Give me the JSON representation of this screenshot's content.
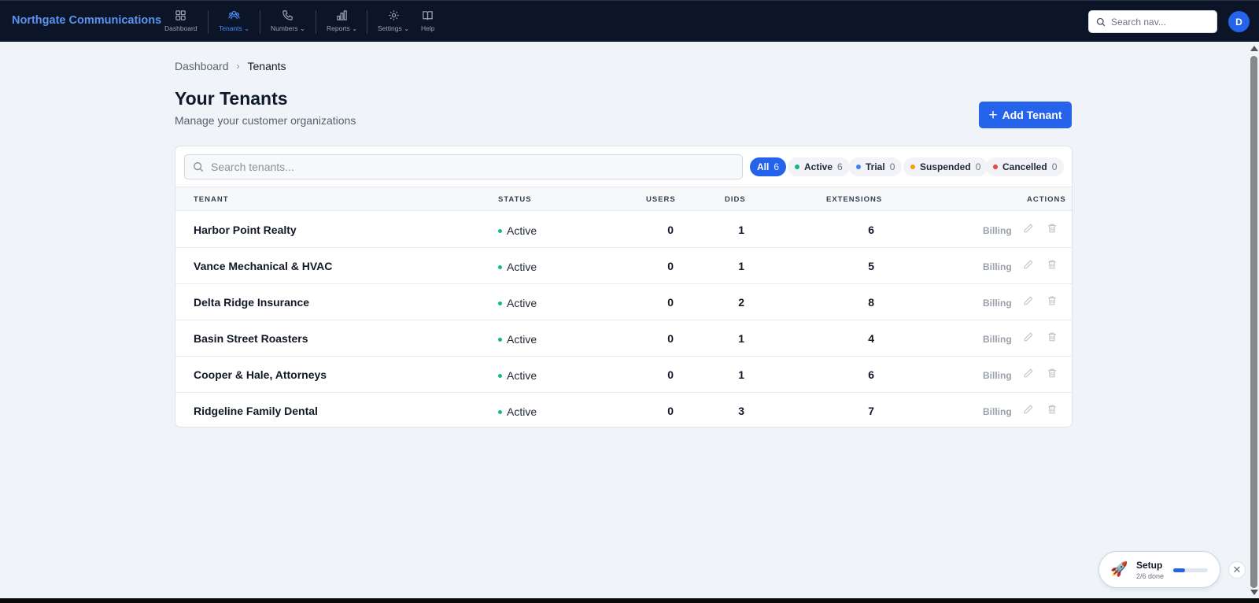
{
  "app": {
    "brand": "Northgate Communications"
  },
  "nav": {
    "items": [
      {
        "label": "Dashboard",
        "icon": "grid-icon"
      },
      {
        "label": "Tenants",
        "icon": "users-icon",
        "active": true
      },
      {
        "label": "Numbers",
        "icon": "phone-icon"
      },
      {
        "label": "Reports",
        "icon": "bar-chart-icon"
      },
      {
        "label": "Settings",
        "icon": "gear-icon"
      },
      {
        "label": "Help",
        "icon": "book-icon"
      }
    ],
    "search_placeholder": "Search nav...",
    "avatar_initial": "D"
  },
  "breadcrumb": {
    "root": "Dashboard",
    "current": "Tenants"
  },
  "header": {
    "title": "Your Tenants",
    "subtitle": "Manage your customer organizations",
    "add_label": "Add Tenant"
  },
  "filters": {
    "search_placeholder": "Search tenants...",
    "chips": [
      {
        "label": "All",
        "count": "6",
        "selected": true
      },
      {
        "label": "Active",
        "count": "6",
        "color": "#10b981"
      },
      {
        "label": "Trial",
        "count": "0",
        "color": "#3b82f6"
      },
      {
        "label": "Suspended",
        "count": "0",
        "color": "#f59e0b"
      },
      {
        "label": "Cancelled",
        "count": "0",
        "color": "#ef4444"
      }
    ]
  },
  "table": {
    "columns": {
      "tenant": "TENANT",
      "status": "STATUS",
      "users": "USERS",
      "dids": "DIDS",
      "extensions": "EXTENSIONS",
      "actions": "ACTIONS"
    },
    "rows": [
      {
        "name": "Harbor Point Realty",
        "status": "Active",
        "users": "0",
        "dids": "1",
        "extensions": "6",
        "billing": "Billing"
      },
      {
        "name": "Vance Mechanical & HVAC",
        "status": "Active",
        "users": "0",
        "dids": "1",
        "extensions": "5",
        "billing": "Billing"
      },
      {
        "name": "Delta Ridge Insurance",
        "status": "Active",
        "users": "0",
        "dids": "2",
        "extensions": "8",
        "billing": "Billing"
      },
      {
        "name": "Basin Street Roasters",
        "status": "Active",
        "users": "0",
        "dids": "1",
        "extensions": "4",
        "billing": "Billing"
      },
      {
        "name": "Cooper & Hale, Attorneys",
        "status": "Active",
        "users": "0",
        "dids": "1",
        "extensions": "6",
        "billing": "Billing"
      },
      {
        "name": "Ridgeline Family Dental",
        "status": "Active",
        "users": "0",
        "dids": "3",
        "extensions": "7",
        "billing": "Billing"
      }
    ]
  },
  "setup": {
    "title": "Setup",
    "progress_text": "2/6 done",
    "progress": 0.33,
    "icon": "rocket-icon"
  },
  "colors": {
    "accent": "#2563eb",
    "nav_bg": "#0c1527",
    "active_status": "#10b981"
  }
}
